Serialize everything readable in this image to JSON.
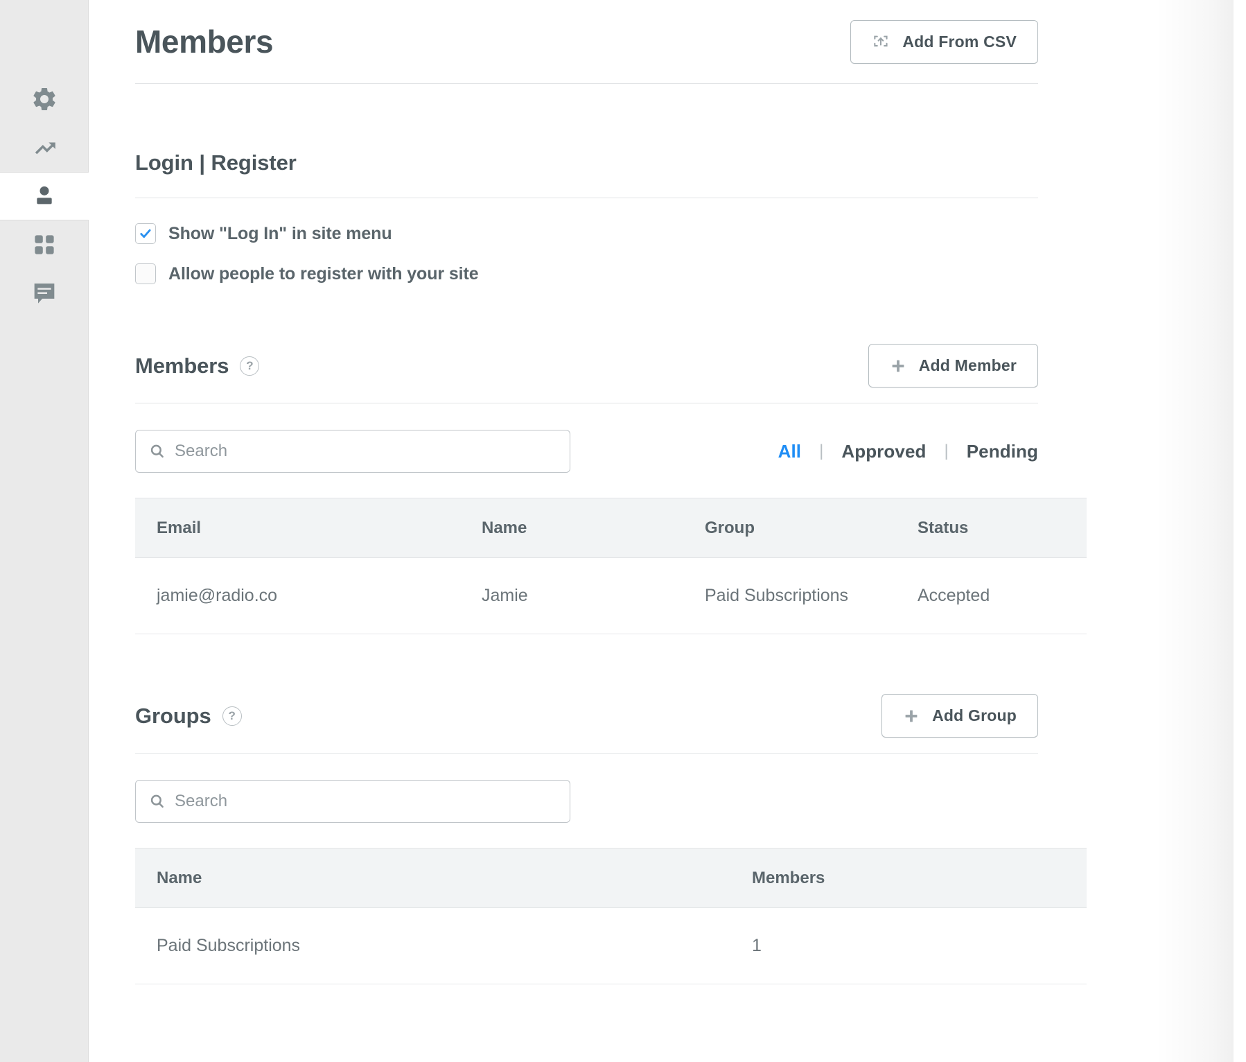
{
  "sidebar": {
    "items": [
      {
        "name": "settings",
        "icon": "gear-icon",
        "active": false
      },
      {
        "name": "analytics",
        "icon": "trending-up-icon",
        "active": false
      },
      {
        "name": "members",
        "icon": "person-icon",
        "active": true
      },
      {
        "name": "apps",
        "icon": "grid-icon",
        "active": false
      },
      {
        "name": "comments",
        "icon": "comment-icon",
        "active": false
      }
    ]
  },
  "header": {
    "title": "Members",
    "add_from_csv_label": "Add From CSV",
    "add_from_csv_icon": "upload-icon"
  },
  "login_register": {
    "title": "Login | Register",
    "options": [
      {
        "label": "Show \"Log In\" in site menu",
        "checked": true
      },
      {
        "label": "Allow people to register with your site",
        "checked": false
      }
    ]
  },
  "members": {
    "title": "Members",
    "help_icon": "question-mark-icon",
    "add_button_label": "Add Member",
    "add_button_icon": "plus-icon",
    "search": {
      "value": "",
      "placeholder": "Search",
      "icon": "search-icon"
    },
    "filters": [
      {
        "label": "All",
        "active": true
      },
      {
        "label": "Approved",
        "active": false
      },
      {
        "label": "Pending",
        "active": false
      }
    ],
    "filter_separator": "|",
    "columns": [
      "Email",
      "Name",
      "Group",
      "Status"
    ],
    "rows": [
      {
        "email": "jamie@radio.co",
        "name": "Jamie",
        "group": "Paid Subscriptions",
        "status": "Accepted"
      }
    ]
  },
  "groups": {
    "title": "Groups",
    "help_icon": "question-mark-icon",
    "add_button_label": "Add Group",
    "add_button_icon": "plus-icon",
    "search": {
      "value": "",
      "placeholder": "Search",
      "icon": "search-icon"
    },
    "columns": [
      "Name",
      "Members"
    ],
    "rows": [
      {
        "name": "Paid Subscriptions",
        "members": "1"
      }
    ]
  },
  "colors": {
    "accent_blue": "#1f8df5",
    "text_dark": "#4a555b",
    "text_muted": "#6b7479",
    "sidebar_bg": "#eaeaea",
    "table_header_bg": "#f2f4f5",
    "border": "#e2e4e6"
  }
}
